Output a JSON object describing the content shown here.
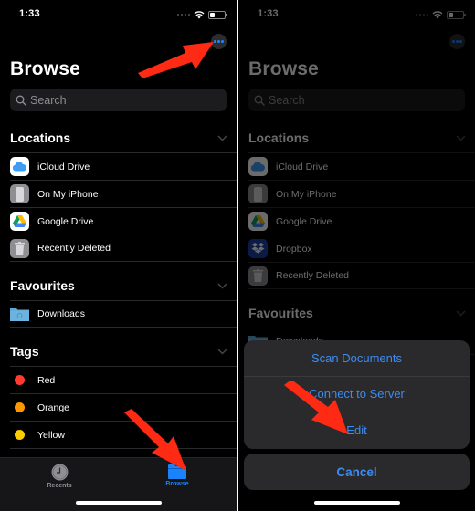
{
  "status_bar": {
    "time": "1:33"
  },
  "left_screen": {
    "title": "Browse",
    "search": {
      "placeholder": "Search"
    },
    "sections": {
      "locations": {
        "title": "Locations",
        "items": [
          {
            "label": "iCloud Drive",
            "icon": "icloud-icon"
          },
          {
            "label": "On My iPhone",
            "icon": "iphone-icon"
          },
          {
            "label": "Google Drive",
            "icon": "google-drive-icon"
          },
          {
            "label": "Recently Deleted",
            "icon": "trash-icon"
          }
        ]
      },
      "favourites": {
        "title": "Favourites",
        "items": [
          {
            "label": "Downloads",
            "icon": "downloads-folder-icon"
          }
        ]
      },
      "tags": {
        "title": "Tags",
        "items": [
          {
            "label": "Red",
            "color": "#ff3b30"
          },
          {
            "label": "Orange",
            "color": "#ff9500"
          },
          {
            "label": "Yellow",
            "color": "#ffcc00"
          }
        ]
      }
    },
    "tab_bar": {
      "tabs": [
        {
          "label": "Recents",
          "icon": "clock-icon",
          "active": false
        },
        {
          "label": "Browse",
          "icon": "folder-icon",
          "active": true
        }
      ]
    }
  },
  "right_screen": {
    "title": "Browse",
    "search": {
      "placeholder": "Search"
    },
    "sections": {
      "locations": {
        "title": "Locations",
        "items": [
          {
            "label": "iCloud Drive",
            "icon": "icloud-icon"
          },
          {
            "label": "On My iPhone",
            "icon": "iphone-icon"
          },
          {
            "label": "Google Drive",
            "icon": "google-drive-icon"
          },
          {
            "label": "Dropbox",
            "icon": "dropbox-icon"
          },
          {
            "label": "Recently Deleted",
            "icon": "trash-icon"
          }
        ]
      },
      "favourites": {
        "title": "Favourites",
        "items": [
          {
            "label": "Downloads",
            "icon": "downloads-folder-icon"
          }
        ]
      }
    },
    "action_sheet": {
      "items": [
        {
          "label": "Scan Documents"
        },
        {
          "label": "Connect to Server"
        },
        {
          "label": "Edit"
        }
      ],
      "cancel_label": "Cancel"
    }
  },
  "colors": {
    "accent": "#1a82fb",
    "action_text": "#3d8cf0",
    "annotation_arrow": "#ff2a14",
    "background": "#000000"
  }
}
